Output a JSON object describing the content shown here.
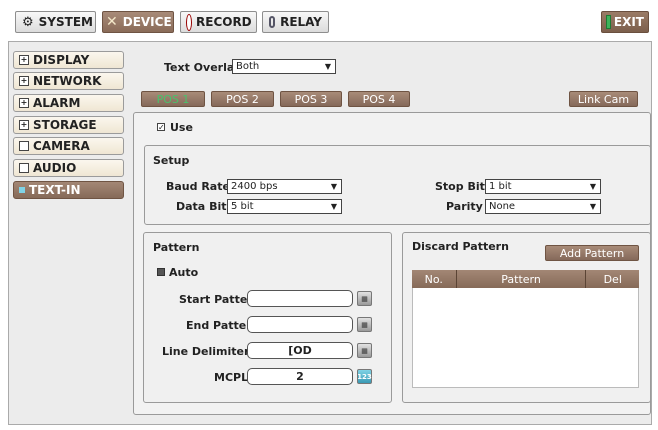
{
  "header": {
    "system": "SYSTEM",
    "device": "DEVICE",
    "record": "RECORD",
    "relay": "RELAY",
    "exit": "EXIT"
  },
  "sidebar": {
    "items": [
      {
        "label": "DISPLAY",
        "toggle": "+"
      },
      {
        "label": "NETWORK",
        "toggle": "+"
      },
      {
        "label": "ALARM",
        "toggle": "+"
      },
      {
        "label": "STORAGE",
        "toggle": "+"
      },
      {
        "label": "CAMERA",
        "toggle": ""
      },
      {
        "label": "AUDIO",
        "toggle": ""
      },
      {
        "label": "TEXT-IN",
        "toggle": ""
      }
    ]
  },
  "overlay": {
    "label": "Text Overlay",
    "value": "Both"
  },
  "tabs": [
    "POS 1",
    "POS 2",
    "POS 3",
    "POS 4"
  ],
  "link_cam": "Link Cam",
  "use": {
    "label": "Use",
    "checked": true
  },
  "setup": {
    "title": "Setup",
    "baud_rate": {
      "label": "Baud Rate",
      "value": "2400 bps"
    },
    "data_bit": {
      "label": "Data Bit",
      "value": "5 bit"
    },
    "stop_bit": {
      "label": "Stop Bit",
      "value": "1 bit"
    },
    "parity": {
      "label": "Parity",
      "value": "None"
    }
  },
  "pattern": {
    "title": "Pattern",
    "auto": "Auto",
    "start_label": "Start Pattern",
    "start_value": "",
    "end_label": "End Pattern",
    "end_value": "",
    "delim_label": "Line Delimiter",
    "delim_value": "[OD",
    "mcpl_label": "MCPL",
    "mcpl_value": "2",
    "num_key": "123"
  },
  "discard": {
    "title": "Discard Pattern",
    "add": "Add Pattern",
    "columns": [
      "No.",
      "Pattern",
      "Del"
    ]
  },
  "colors": {
    "accent": "#8a6b58",
    "active_tab_text": "#49c26b",
    "exit_icon": "#3cb35a"
  }
}
